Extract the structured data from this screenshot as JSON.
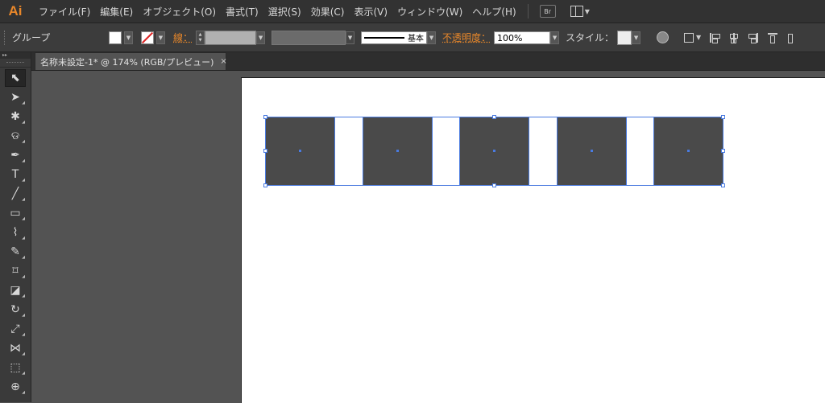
{
  "app": {
    "logo": "Ai",
    "accent_color": "#e8872a",
    "selection_color": "#4a7be0"
  },
  "menu": {
    "items": [
      "ファイル(F)",
      "編集(E)",
      "オブジェクト(O)",
      "書式(T)",
      "選択(S)",
      "効果(C)",
      "表示(V)",
      "ウィンドウ(W)",
      "ヘルプ(H)"
    ],
    "bridge_label": "Br",
    "workspace_icon": "workspace-switcher-icon"
  },
  "control_bar": {
    "selection_type": "グループ",
    "stroke_label": "線：",
    "stroke_style_label": "基本",
    "opacity_label": "不透明度：",
    "opacity_value": "100%",
    "style_label": "スタイル：",
    "fill_color": "#ffffff",
    "stroke_color": "none"
  },
  "document": {
    "tab_title": "名称未設定-1* @ 174% (RGB/プレビュー)",
    "close_glyph": "×"
  },
  "tools": {
    "header": "▸▸",
    "items": [
      {
        "name": "selection-tool",
        "glyph": "⬉"
      },
      {
        "name": "direct-selection-tool",
        "glyph": "➤"
      },
      {
        "name": "magic-wand-tool",
        "glyph": "✱"
      },
      {
        "name": "lasso-tool",
        "glyph": "ଡ"
      },
      {
        "name": "pen-tool",
        "glyph": "✒"
      },
      {
        "name": "type-tool",
        "glyph": "T"
      },
      {
        "name": "line-segment-tool",
        "glyph": "╱"
      },
      {
        "name": "rectangle-tool",
        "glyph": "▭"
      },
      {
        "name": "paintbrush-tool",
        "glyph": "⌇"
      },
      {
        "name": "pencil-tool",
        "glyph": "✎"
      },
      {
        "name": "blob-brush-tool",
        "glyph": "⌑"
      },
      {
        "name": "eraser-tool",
        "glyph": "◪"
      },
      {
        "name": "rotate-tool",
        "glyph": "↻"
      },
      {
        "name": "scale-tool",
        "glyph": "⤢"
      },
      {
        "name": "width-tool",
        "glyph": "⋈"
      },
      {
        "name": "free-transform-tool",
        "glyph": "⬚"
      },
      {
        "name": "shape-builder-tool",
        "glyph": "⊕"
      }
    ]
  },
  "canvas": {
    "artboard_color": "#ffffff",
    "object_fill": "#4a4a4a",
    "squares": [
      {
        "id": "square-1"
      },
      {
        "id": "square-2"
      },
      {
        "id": "square-3"
      },
      {
        "id": "square-4"
      },
      {
        "id": "square-5"
      }
    ]
  }
}
